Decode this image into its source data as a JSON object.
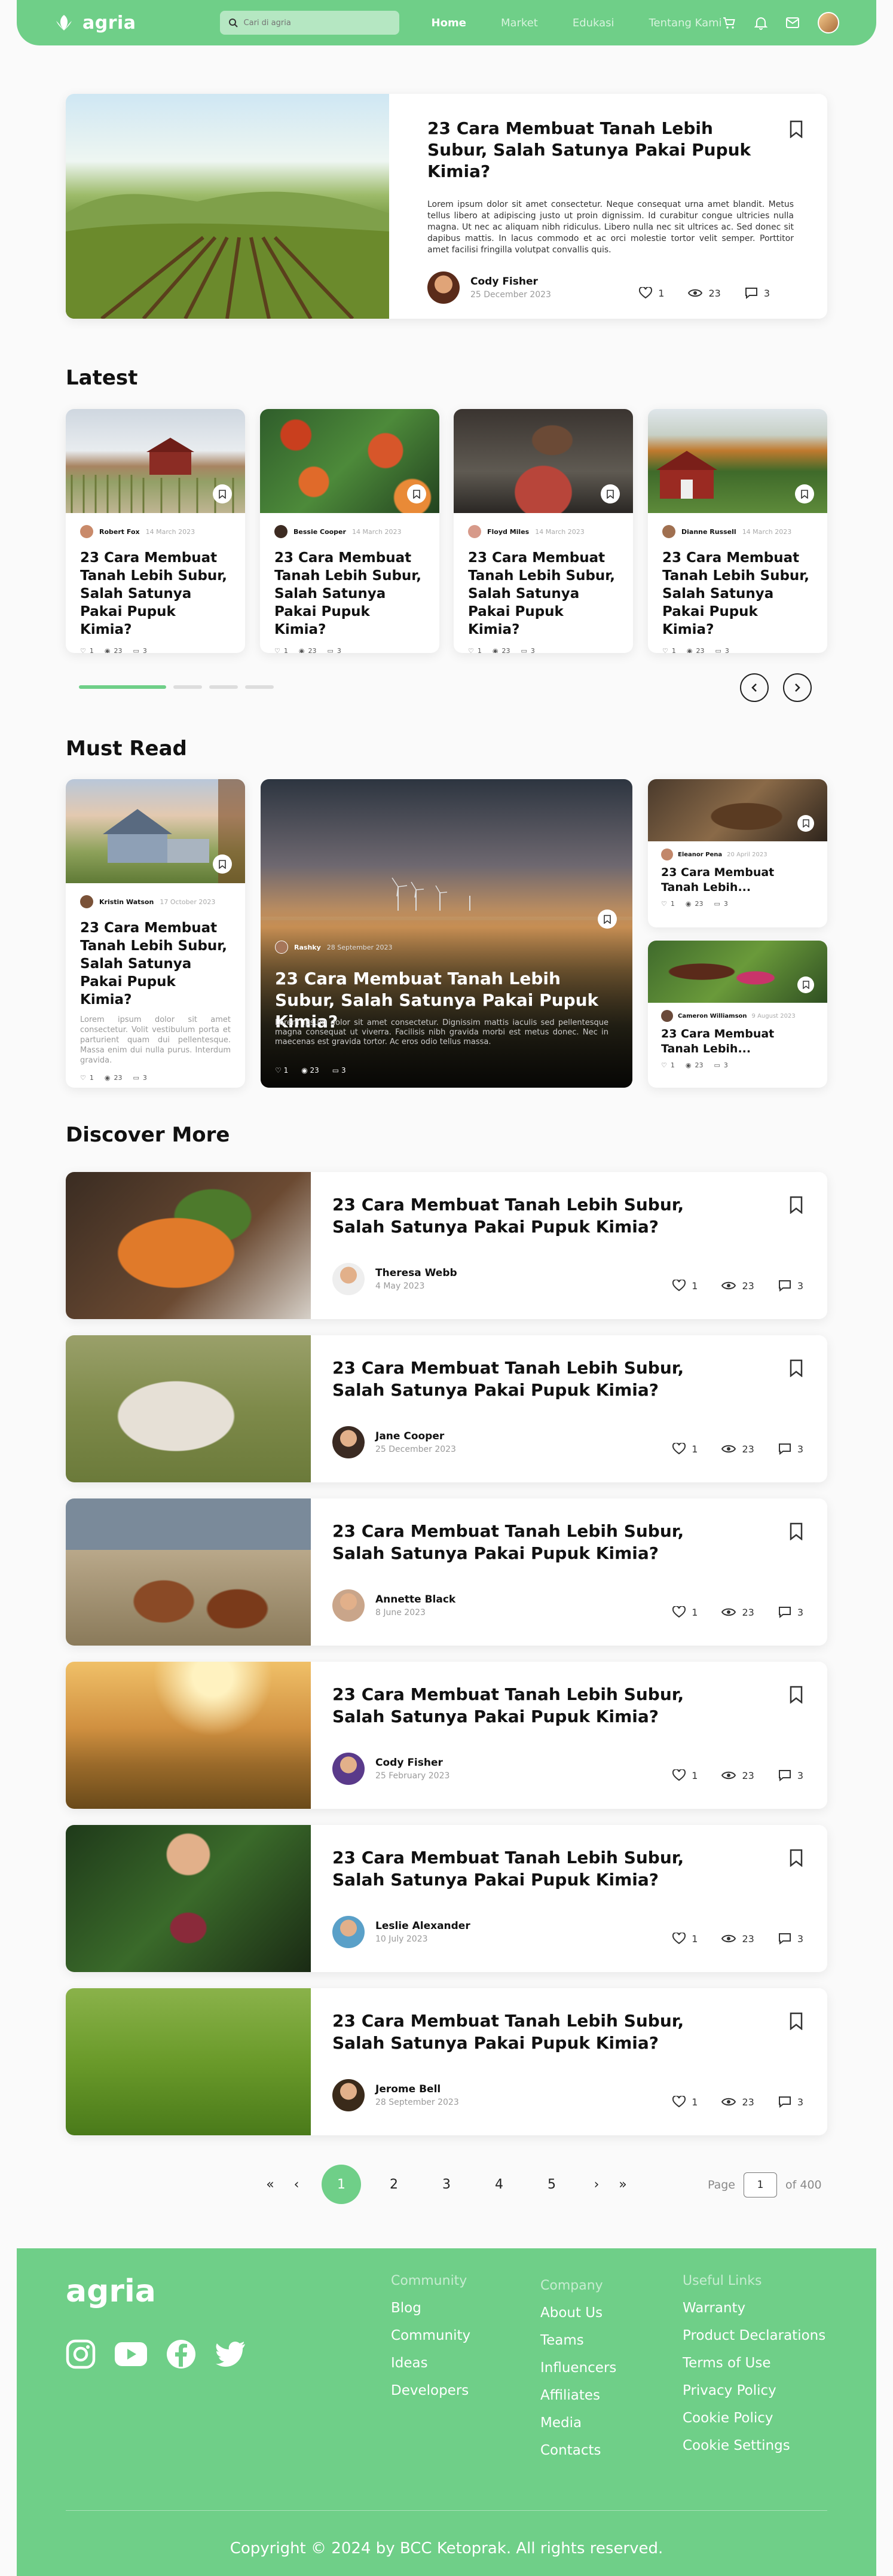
{
  "nav": {
    "brand": "agria",
    "search_placeholder": "Cari di agria",
    "links": [
      "Home",
      "Market",
      "Edukasi",
      "Tentang Kami"
    ],
    "icons": [
      "cart-icon",
      "bell-icon",
      "mail-icon"
    ]
  },
  "featured": {
    "title": "23 Cara Membuat Tanah Lebih Subur, Salah Satunya Pakai Pupuk Kimia?",
    "excerpt": "Lorem ipsum dolor sit amet consectetur. Neque consequat urna amet blandit. Metus tellus libero at adipiscing justo ut proin dignissim. Id curabitur congue ultricies nulla magna. Ut nec ac aliquam nibh ridiculus. Libero nulla nec sit ultrices ac. Sed donec sit dapibus mattis. In lacus commodo et ac orci molestie tortor velit semper. Porttitor amet facilisi fringilla volutpat convallis quis.",
    "author": "Cody Fisher",
    "date": "25 December 2023",
    "likes": "1",
    "views": "23",
    "comments": "3"
  },
  "latest": {
    "heading": "Latest",
    "cards": [
      {
        "author": "Robert Fox",
        "date": "14 March 2023",
        "title": "23 Cara Membuat Tanah Lebih Subur, Salah Satunya Pakai Pupuk Kimia?",
        "likes": "1",
        "views": "23",
        "comments": "3"
      },
      {
        "author": "Bessie Cooper",
        "date": "14 March 2023",
        "title": "23 Cara Membuat Tanah Lebih Subur, Salah Satunya Pakai Pupuk Kimia?",
        "likes": "1",
        "views": "23",
        "comments": "3"
      },
      {
        "author": "Floyd Miles",
        "date": "14 March 2023",
        "title": "23 Cara Membuat Tanah Lebih Subur, Salah Satunya Pakai Pupuk Kimia?",
        "likes": "1",
        "views": "23",
        "comments": "3"
      },
      {
        "author": "Dianne Russell",
        "date": "14 March 2023",
        "title": "23 Cara Membuat Tanah Lebih Subur, Salah Satunya Pakai Pupuk Kimia?",
        "likes": "1",
        "views": "23",
        "comments": "3"
      }
    ]
  },
  "must_read": {
    "heading": "Must Read",
    "left": {
      "author": "Kristin Watson",
      "date": "17 October 2023",
      "title": "23 Cara Membuat Tanah Lebih Subur, Salah Satunya Pakai Pupuk Kimia?",
      "excerpt": "Lorem ipsum dolor sit amet consectetur. Volit vestibulum porta et parturient quam dui pellentesque. Massa enim dui nulla purus. Interdum gravida.",
      "likes": "1",
      "views": "23",
      "comments": "3"
    },
    "big": {
      "author": "Rashky",
      "date": "28 September 2023",
      "title": "23 Cara Membuat Tanah Lebih Subur, Salah Satunya Pakai Pupuk Kimia?",
      "excerpt": "Lorem ipsum dolor sit amet consectetur. Dignissim mattis iaculis sed pellentesque magna consequat ut viverra. Facilisis nibh gravida morbi est metus donec. Nec in maecenas est gravida tortor. Ac eros odio tellus massa.",
      "likes": "1",
      "views": "23",
      "comments": "3"
    },
    "small": [
      {
        "author": "Eleanor Pena",
        "date": "20 April 2023",
        "title": "23 Cara Membuat Tanah Lebih...",
        "likes": "1",
        "views": "23",
        "comments": "3"
      },
      {
        "author": "Cameron Williamson",
        "date": "9 August 2023",
        "title": "23 Cara Membuat Tanah Lebih...",
        "likes": "1",
        "views": "23",
        "comments": "3"
      }
    ]
  },
  "discover": {
    "heading": "Discover More",
    "items": [
      {
        "title": "23 Cara Membuat Tanah Lebih Subur, Salah Satunya Pakai Pupuk Kimia?",
        "author": "Theresa Webb",
        "date": "4 May 2023",
        "likes": "1",
        "views": "23",
        "comments": "3"
      },
      {
        "title": "23 Cara Membuat Tanah Lebih Subur, Salah Satunya Pakai Pupuk Kimia?",
        "author": "Jane Cooper",
        "date": "25 December 2023",
        "likes": "1",
        "views": "23",
        "comments": "3"
      },
      {
        "title": "23 Cara Membuat Tanah Lebih Subur, Salah Satunya Pakai Pupuk Kimia?",
        "author": "Annette Black",
        "date": "8 June 2023",
        "likes": "1",
        "views": "23",
        "comments": "3"
      },
      {
        "title": "23 Cara Membuat Tanah Lebih Subur, Salah Satunya Pakai Pupuk Kimia?",
        "author": "Cody Fisher",
        "date": "25 February 2023",
        "likes": "1",
        "views": "23",
        "comments": "3"
      },
      {
        "title": "23 Cara Membuat Tanah Lebih Subur, Salah Satunya Pakai Pupuk Kimia?",
        "author": "Leslie Alexander",
        "date": "10 July 2023",
        "likes": "1",
        "views": "23",
        "comments": "3"
      },
      {
        "title": "23 Cara Membuat Tanah Lebih Subur, Salah Satunya Pakai Pupuk Kimia?",
        "author": "Jerome Bell",
        "date": "28 September 2023",
        "likes": "1",
        "views": "23",
        "comments": "3"
      }
    ]
  },
  "pagination": {
    "first": "«",
    "prev": "‹",
    "next": "›",
    "last": "»",
    "pages": [
      "1",
      "2",
      "3",
      "4",
      "5"
    ],
    "current": "1",
    "page_label": "Page",
    "page_input": "1",
    "of_total": "of 400"
  },
  "footer": {
    "brand": "agria",
    "social": [
      "instagram-icon",
      "youtube-icon",
      "facebook-icon",
      "twitter-icon"
    ],
    "columns": [
      {
        "heading": "Community",
        "links": [
          "Blog",
          "Community",
          "Ideas",
          "Developers"
        ]
      },
      {
        "heading": "Company",
        "links": [
          "About Us",
          "Teams",
          "Influencers",
          "Affiliates",
          "Media",
          "Contacts"
        ]
      },
      {
        "heading": "Useful Links",
        "links": [
          "Warranty",
          "Product Declarations",
          "Terms of Use",
          "Privacy Policy",
          "Cookie Policy",
          "Cookie Settings"
        ]
      }
    ],
    "copyright": "Copyright © 2024 by BCC Ketoprak. All rights reserved."
  },
  "colors": {
    "brand_green": "#6fcf88",
    "text": "#111111",
    "muted": "#999999"
  }
}
